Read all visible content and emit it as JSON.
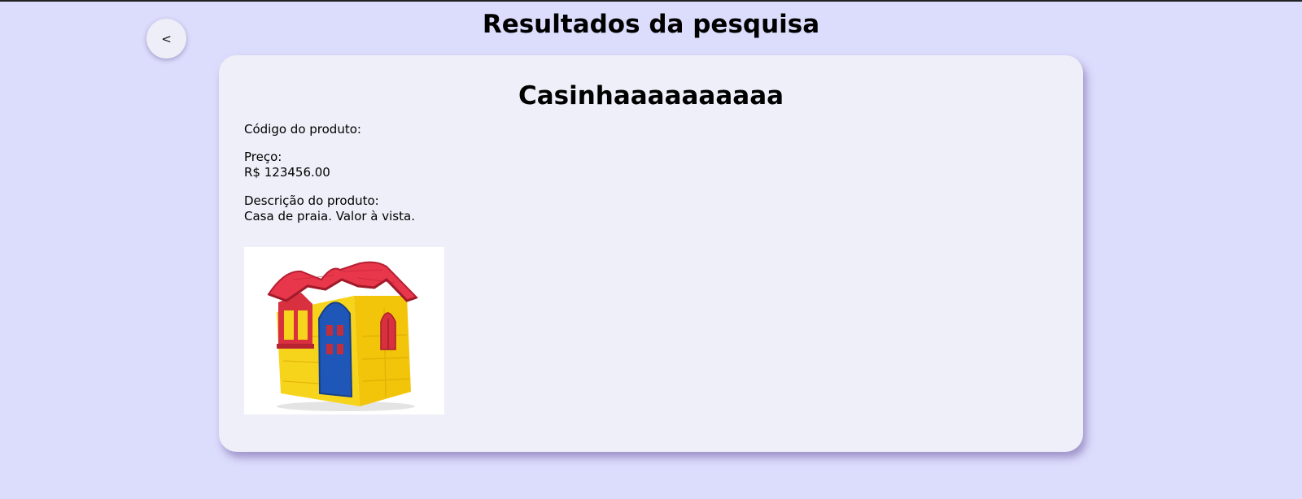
{
  "header": {
    "back_label": "<",
    "title": "Resultados da pesquisa"
  },
  "product": {
    "name": "Casinhaaaaaaaaaa",
    "code_label": "Código do produto:",
    "code_value": "",
    "price_label": "Preço:",
    "price_value": "R$ 123456.00",
    "description_label": "Descrição do produto:",
    "description_value": "Casa de praia. Valor à vista.",
    "image_icon": "toy-playhouse-image"
  },
  "colors": {
    "background": "#dcdcfc",
    "card": "#eeeff8",
    "roof": "#e8364a",
    "wall": "#f6d20a",
    "door": "#1f57b8"
  }
}
